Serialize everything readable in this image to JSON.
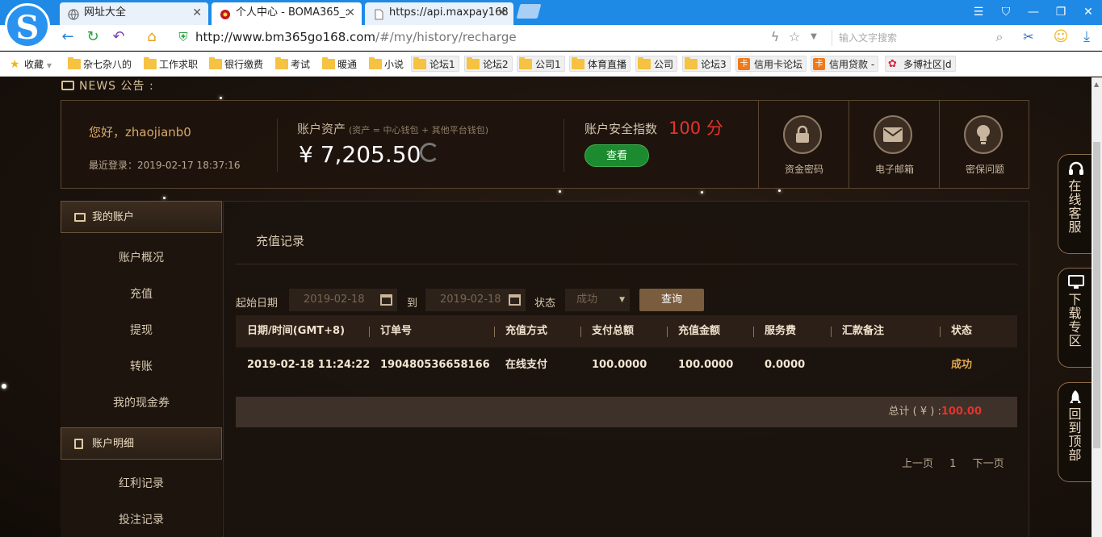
{
  "browser": {
    "tabs": [
      {
        "title": "网址大全",
        "icon": "globe-icon"
      },
      {
        "title": "个人中心 - BOMA365_:",
        "icon": "site-icon"
      },
      {
        "title": "https://api.maxpay168",
        "icon": "page-icon"
      }
    ],
    "url_host": "http://www.bm365go168.com",
    "url_path": "/#/my/history/recharge",
    "search_placeholder": "输入文字搜索",
    "bookmarks": [
      "收藏",
      "杂七杂八的",
      "工作求职",
      "银行缴费",
      "考试",
      "暖通",
      "小说",
      "论坛1",
      "论坛2",
      "公司1",
      "体育直播",
      "公司",
      "论坛3",
      "信用卡论坛",
      "信用贷款 -",
      "多博社区|d"
    ]
  },
  "news": {
    "label": "NEWS 公告 :"
  },
  "account": {
    "greeting": "您好，zhaojianb0",
    "last_login": "最近登录：2019-02-17 18:37:16",
    "asset_label": "账户资产",
    "asset_note": "(资产 = 中心钱包 + 其他平台钱包)",
    "asset_value": "¥ 7,205.50",
    "security_label": "账户安全指数",
    "security_value": "100 分",
    "security_button": "查看",
    "quick": [
      {
        "label": "资金密码",
        "icon": "lock-icon"
      },
      {
        "label": "电子邮箱",
        "icon": "mail-icon"
      },
      {
        "label": "密保问题",
        "icon": "lightbulb-icon"
      }
    ]
  },
  "sidebar": {
    "section1": "我的账户",
    "items1": [
      "账户概况",
      "充值",
      "提现",
      "转账",
      "我的现金券"
    ],
    "section2": "账户明细",
    "items2": [
      "红利记录",
      "投注记录"
    ]
  },
  "main": {
    "title": "充值记录",
    "filter": {
      "start_label": "起始日期",
      "start_value": "2019-02-18",
      "to_label": "到",
      "end_value": "2019-02-18",
      "status_label": "状态",
      "status_value": "成功",
      "query_button": "查询"
    },
    "columns": [
      "日期/时间(GMT+8)",
      "订单号",
      "充值方式",
      "支付总额",
      "充值金额",
      "服务费",
      "汇款备注",
      "状态"
    ],
    "rows": [
      [
        "2019-02-18 11:24:22",
        "190480536658166",
        "在线支付",
        "100.0000",
        "100.0000",
        "0.0000",
        "",
        "成功"
      ]
    ],
    "total_label": "总计 ( ¥ ) :",
    "total_value": "100.00",
    "pager": {
      "prev": "上一页",
      "page": "1",
      "next": "下一页"
    }
  },
  "floating": [
    {
      "label": "在线客服",
      "icon": "headset-icon"
    },
    {
      "label": "下载专区",
      "icon": "monitor-icon"
    },
    {
      "label": "回到顶部",
      "icon": "rocket-icon"
    }
  ],
  "colors": {
    "accent_gold": "#d8a86a",
    "danger_red": "#e5332b",
    "success_green": "#1c8a2e",
    "status_gold": "#e0a84a"
  }
}
